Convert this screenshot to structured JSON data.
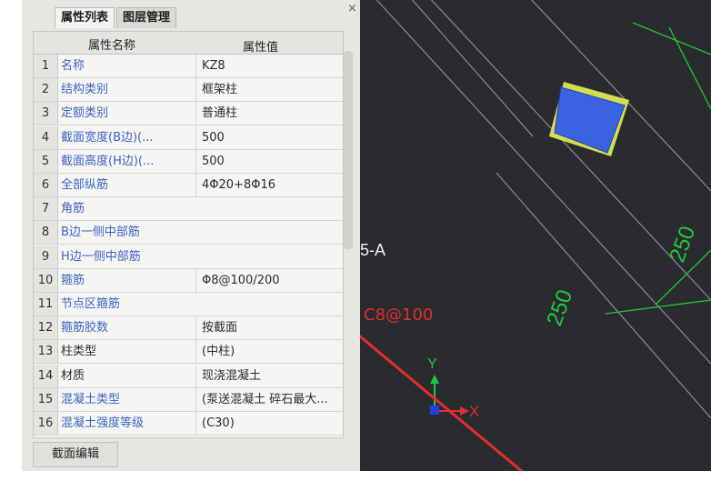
{
  "panel": {
    "tabs": [
      "属性列表",
      "图层管理"
    ],
    "close_glyph": "×",
    "columns": [
      "属性名称",
      "属性值"
    ],
    "rows": [
      {
        "no": "1",
        "name": "名称",
        "value": "KZ8"
      },
      {
        "no": "2",
        "name": "结构类别",
        "value": "框架柱"
      },
      {
        "no": "3",
        "name": "定额类别",
        "value": "普通柱"
      },
      {
        "no": "4",
        "name": "截面宽度(B边)(...",
        "value": "500"
      },
      {
        "no": "5",
        "name": "截面高度(H边)(...",
        "value": "500"
      },
      {
        "no": "6",
        "name": "全部纵筋",
        "value": "4Φ20+8Φ16"
      },
      {
        "no": "7",
        "name": "角筋",
        "value": ""
      },
      {
        "no": "8",
        "name": "B边一侧中部筋",
        "value": ""
      },
      {
        "no": "9",
        "name": "H边一侧中部筋",
        "value": ""
      },
      {
        "no": "10",
        "name": "箍筋",
        "value": "Φ8@100/200"
      },
      {
        "no": "11",
        "name": "节点区箍筋",
        "value": ""
      },
      {
        "no": "12",
        "name": "箍筋胶数",
        "value": "按截面"
      },
      {
        "no": "13",
        "name": "柱类型",
        "value": "(中柱)"
      },
      {
        "no": "14",
        "name": "材质",
        "value": "现浇混凝土"
      },
      {
        "no": "15",
        "name": "混凝土类型",
        "value": "(泵送混凝土 碎石最大..."
      },
      {
        "no": "16",
        "name": "混凝土强度等级",
        "value": "(C30)"
      }
    ],
    "edit_button": "截面编辑"
  },
  "cad": {
    "axis_label": "5-A",
    "dim_1": "250",
    "dim_2": "250",
    "annotation": "C8@100",
    "y_axis": "Y",
    "x_axis": "X"
  },
  "colors": {
    "column_fill": "#3a63e0",
    "cad_line": "#21c73a",
    "annotation": "#e22d2d"
  }
}
